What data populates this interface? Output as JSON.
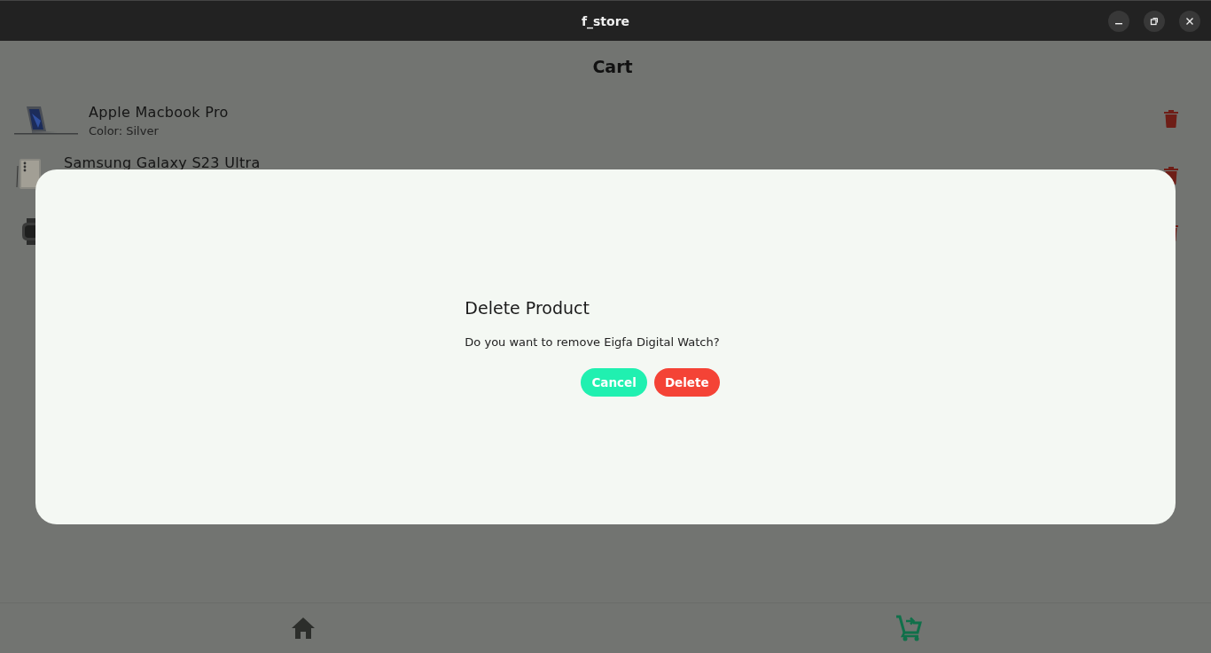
{
  "window": {
    "title": "f_store"
  },
  "page": {
    "title": "Cart"
  },
  "cart_items": [
    {
      "kind": "laptop",
      "name": "Apple Macbook Pro",
      "detail": "Color: Silver"
    },
    {
      "kind": "phone",
      "name": "Samsung Galaxy S23 Ultra"
    },
    {
      "kind": "watch"
    }
  ],
  "dialog": {
    "title": "Delete Product",
    "message": "Do you want to remove Eigfa Digital Watch?",
    "buttons": [
      {
        "label": "Cancel",
        "kind": "cancel"
      },
      {
        "label": "Delete",
        "kind": "delete"
      }
    ]
  },
  "nav": [
    {
      "kind": "home",
      "selected": false
    },
    {
      "kind": "cart",
      "selected": true
    }
  ]
}
